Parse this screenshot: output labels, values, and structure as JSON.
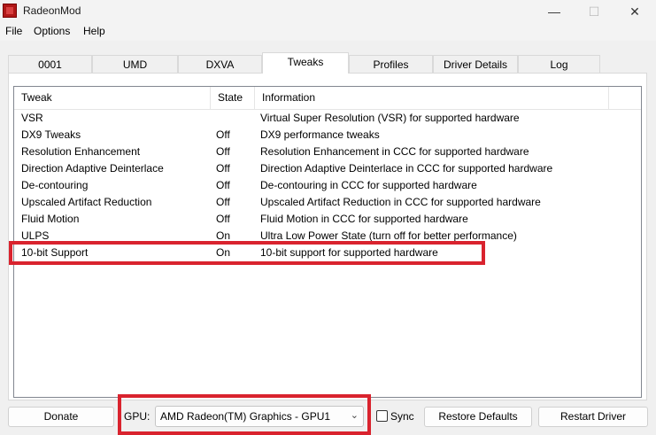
{
  "window": {
    "title": "RadeonMod",
    "controls": [
      "—",
      "☐",
      "✕"
    ]
  },
  "menu": [
    "File",
    "Options",
    "Help"
  ],
  "tabs": [
    "0001",
    "UMD",
    "DXVA",
    "Tweaks",
    "Profiles",
    "Driver Details",
    "Log"
  ],
  "active_tab": "Tweaks",
  "table": {
    "headers": [
      "Tweak",
      "State",
      "Information"
    ],
    "rows": [
      {
        "tweak": "VSR",
        "state": "",
        "info": "Virtual Super Resolution (VSR) for supported hardware"
      },
      {
        "tweak": "DX9 Tweaks",
        "state": "Off",
        "info": "DX9 performance tweaks"
      },
      {
        "tweak": "Resolution Enhancement",
        "state": "Off",
        "info": "Resolution Enhancement in CCC for supported hardware"
      },
      {
        "tweak": "Direction Adaptive Deinterlace",
        "state": "Off",
        "info": "Direction Adaptive Deinterlace in CCC for supported hardware"
      },
      {
        "tweak": "De-contouring",
        "state": "Off",
        "info": "De-contouring in CCC for supported hardware"
      },
      {
        "tweak": "Upscaled Artifact Reduction",
        "state": "Off",
        "info": "Upscaled Artifact Reduction in CCC for supported hardware"
      },
      {
        "tweak": "Fluid Motion",
        "state": "Off",
        "info": "Fluid Motion in CCC for supported hardware"
      },
      {
        "tweak": "ULPS",
        "state": "On",
        "info": "Ultra Low Power State (turn off for better performance)"
      },
      {
        "tweak": "10-bit Support",
        "state": "On",
        "info": "10-bit support for supported hardware"
      }
    ]
  },
  "footer": {
    "donate_label": "Donate",
    "gpu_label": "GPU:",
    "gpu_value": "AMD Radeon(TM) Graphics - GPU1",
    "sync_label": "Sync",
    "sync_checked": false,
    "restore_label": "Restore Defaults",
    "restart_label": "Restart Driver"
  },
  "highlight_color": "#d9232e"
}
